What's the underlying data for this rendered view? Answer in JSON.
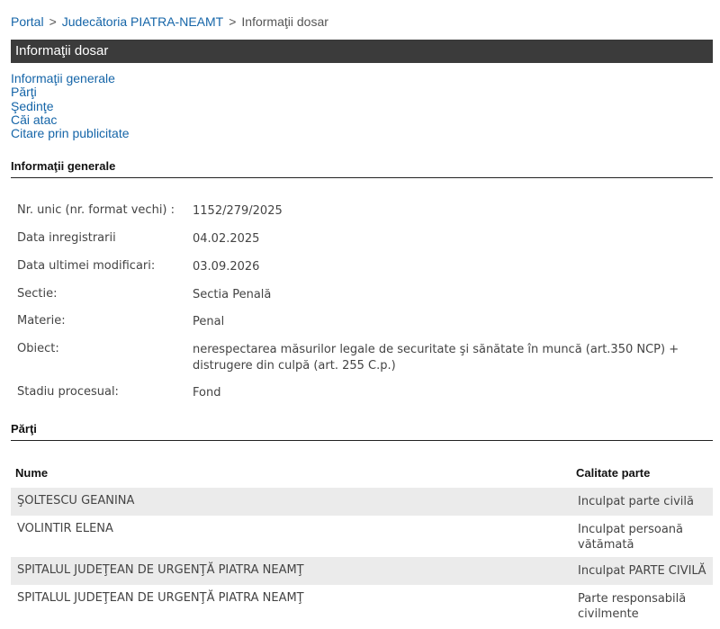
{
  "breadcrumb": {
    "portal": "Portal",
    "sep1": ">",
    "court": "Judecătoria PIATRA-NEAMT",
    "sep2": ">",
    "current": "Informaţii dosar"
  },
  "title_bar": "Informaţii dosar",
  "anchors": [
    "Informaţii generale",
    "Părţi",
    "Şedinţe",
    "Căi atac",
    "Citare prin publicitate"
  ],
  "general": {
    "heading": "Informaţii generale",
    "rows": [
      {
        "label": "Nr. unic (nr. format vechi) :",
        "value": "1152/279/2025"
      },
      {
        "label": "Data inregistrarii",
        "value": "04.02.2025"
      },
      {
        "label": "Data ultimei modificari:",
        "value": "03.09.2026"
      },
      {
        "label": "Sectie:",
        "value": "Sectia Penală"
      },
      {
        "label": "Materie:",
        "value": "Penal"
      },
      {
        "label": "Obiect:",
        "value": "nerespectarea măsurilor legale de securitate şi sănătate în muncă (art.350 NCP) + distrugere din culpă (art. 255 C.p.)"
      },
      {
        "label": "Stadiu procesual:",
        "value": "Fond"
      }
    ]
  },
  "parti": {
    "heading": "Părţi",
    "col_name": "Nume",
    "col_role": "Calitate parte",
    "rows": [
      {
        "name": "ŞOLTESCU GEANINA",
        "role": "Inculpat parte civilă"
      },
      {
        "name": "VOLINTIR ELENA",
        "role": "Inculpat persoană vătămată"
      },
      {
        "name": "SPITALUL JUDEŢEAN DE URGENŢĂ PIATRA NEAMŢ",
        "role": "Inculpat PARTE CIVILĂ"
      },
      {
        "name": "SPITALUL JUDEŢEAN DE URGENŢĂ PIATRA NEAMŢ",
        "role": "Parte responsabilă civilmente"
      }
    ]
  }
}
